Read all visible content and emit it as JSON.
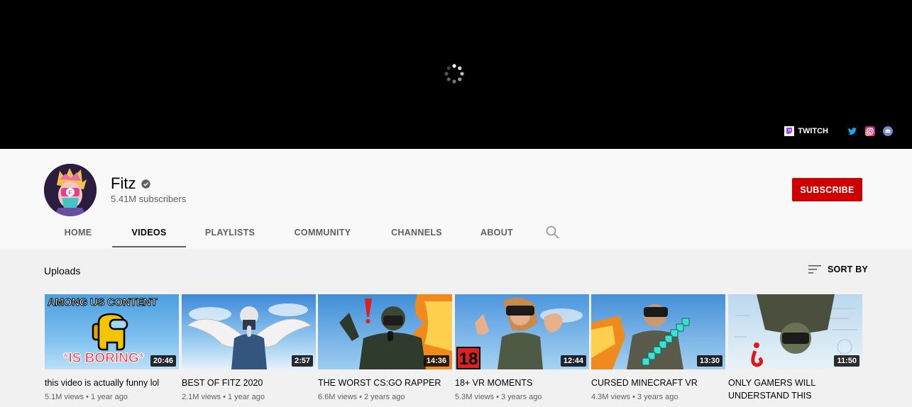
{
  "banner": {
    "links": [
      {
        "label": "TWITCH",
        "icon": "twitch-icon"
      },
      {
        "icon": "twitter-icon"
      },
      {
        "icon": "instagram-icon"
      },
      {
        "icon": "discord-icon"
      }
    ]
  },
  "channel": {
    "name": "Fitz",
    "subscribers": "5.41M subscribers",
    "subscribe_label": "SUBSCRIBE"
  },
  "tabs": [
    "HOME",
    "VIDEOS",
    "PLAYLISTS",
    "COMMUNITY",
    "CHANNELS",
    "ABOUT"
  ],
  "active_tab": "VIDEOS",
  "section": {
    "title": "Uploads",
    "sort_label": "SORT BY"
  },
  "videos": [
    {
      "title": "this video is actually funny lol",
      "duration": "20:46",
      "views": "5.1M views",
      "age": "1 year ago",
      "thumb_text_top": "AMONG US CONTENT",
      "thumb_text_bottom": "*IS BORING*"
    },
    {
      "title": "BEST OF FITZ 2020",
      "duration": "2:57",
      "views": "2.1M views",
      "age": "1 year ago"
    },
    {
      "title": "THE WORST CS:GO RAPPER",
      "duration": "14:36",
      "views": "6.6M views",
      "age": "2 years ago"
    },
    {
      "title": "18+ VR MOMENTS",
      "duration": "12:44",
      "views": "5.3M views",
      "age": "3 years ago",
      "thumb_badge": "18"
    },
    {
      "title": "CURSED MINECRAFT VR",
      "duration": "13:30",
      "views": "4.3M views",
      "age": "3 years ago"
    },
    {
      "title": "ONLY GAMERS WILL UNDERSTAND THIS",
      "duration": "11:50",
      "views": "",
      "age": ""
    }
  ],
  "colors": {
    "subscribe": "#cc0000",
    "banner": "#000000",
    "background": "#f9f9f9",
    "content_bg": "#f1f1f1"
  }
}
